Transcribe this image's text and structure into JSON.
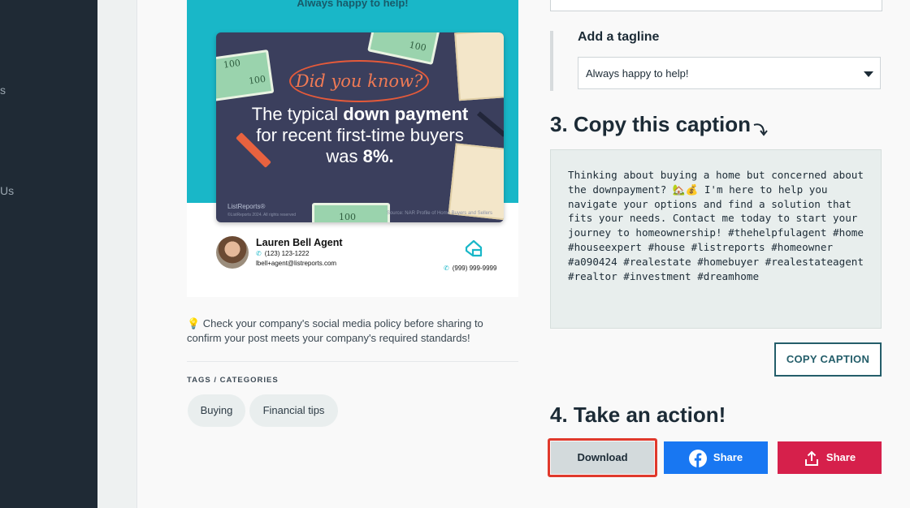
{
  "sidebar": {
    "fragment_1": "s",
    "fragment_2": "Us"
  },
  "post_preview": {
    "top_tagline": "Always happy to help!",
    "graphic": {
      "badge": "Did you know?",
      "headline_pre": "The typical ",
      "headline_bold1": "down payment",
      "headline_mid": " for recent first-time buyers was ",
      "headline_bold2": "8%.",
      "brand": "ListReports®",
      "brand_copy": "©ListReports 2024. All rights reserved",
      "source": "Source: NAR Profile of Home Buyers and Sellers"
    },
    "agent": {
      "name": "Lauren Bell Agent",
      "phone": "(123) 123-1222",
      "email": "lbell+agent@listreports.com",
      "company_phone": "(999) 999-9999"
    }
  },
  "tip": "💡 Check your company's social media policy before sharing to confirm your post meets your company's required standards!",
  "tags": {
    "title": "TAGS / CATEGORIES",
    "items": [
      "Buying",
      "Financial tips"
    ]
  },
  "tagline_section": {
    "label": "Add a tagline",
    "selected": "Always happy to help!"
  },
  "caption_section": {
    "heading": "3. Copy this caption",
    "text": "Thinking about buying a home but concerned about the downpayment? 🏡💰 I'm here to help you navigate your options and find a solution that fits your needs. Contact me today to start your journey to homeownership! #thehelpfulagent #home #houseexpert #house #listreports #homeowner #a090424 #realestate #homebuyer #realestateagent #realtor #investment #dreamhome",
    "copy_button": "COPY CAPTION"
  },
  "action_section": {
    "heading": "4. Take an action!",
    "download": "Download",
    "facebook_share": "Share",
    "share": "Share"
  },
  "colors": {
    "teal": "#19b7c8",
    "facebook": "#1877f2",
    "share_red": "#d6204b",
    "highlight": "#e0392c"
  }
}
